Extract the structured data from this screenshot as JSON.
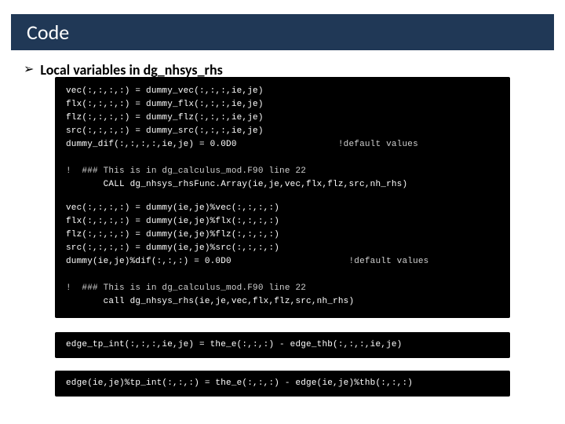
{
  "title": "Code",
  "bullet": "Local variables in dg_nhsys_rhs",
  "code1": {
    "l1": "vec(:,:,:,:) = dummy_vec(:,:,:,ie,je)",
    "l2": "flx(:,:,:,:) = dummy_flx(:,:,:,ie,je)",
    "l3": "flz(:,:,:,:) = dummy_flz(:,:,:,ie,je)",
    "l4": "src(:,:,:,:) = dummy_src(:,:,:,ie,je)",
    "l5": "dummy_dif(:,:,:,:,ie,je) = 0.0D0",
    "l5c": "!default values",
    "l6": "!  ### This is in dg_calculus_mod.F90 line 22",
    "l7": "       CALL dg_nhsys_rhsFunc.Array(ie,je,vec,flx,flz,src,nh_rhs)"
  },
  "code2": {
    "l1": "vec(:,:,:,:) = dummy(ie,je)%vec(:,:,:,:)",
    "l2": "flx(:,:,:,:) = dummy(ie,je)%flx(:,:,:,:)",
    "l3": "flz(:,:,:,:) = dummy(ie,je)%flz(:,:,:,:)",
    "l4": "src(:,:,:,:) = dummy(ie,je)%src(:,:,:,:)",
    "l5": "dummy(ie,je)%dif(:,:,:) = 0.0D0",
    "l5c": "!default values",
    "l6": "!  ### This is in dg_calculus_mod.F90 line 22",
    "l7": "       call dg_nhsys_rhs(ie,je,vec,flx,flz,src,nh_rhs)"
  },
  "code3": "edge_tp_int(:,:,:,ie,je) = the_e(:,:,:) - edge_thb(:,:,:,ie,je)",
  "code4": "edge(ie,je)%tp_int(:,:,:) = the_e(:,:,:) - edge(ie,je)%thb(:,:,:)"
}
